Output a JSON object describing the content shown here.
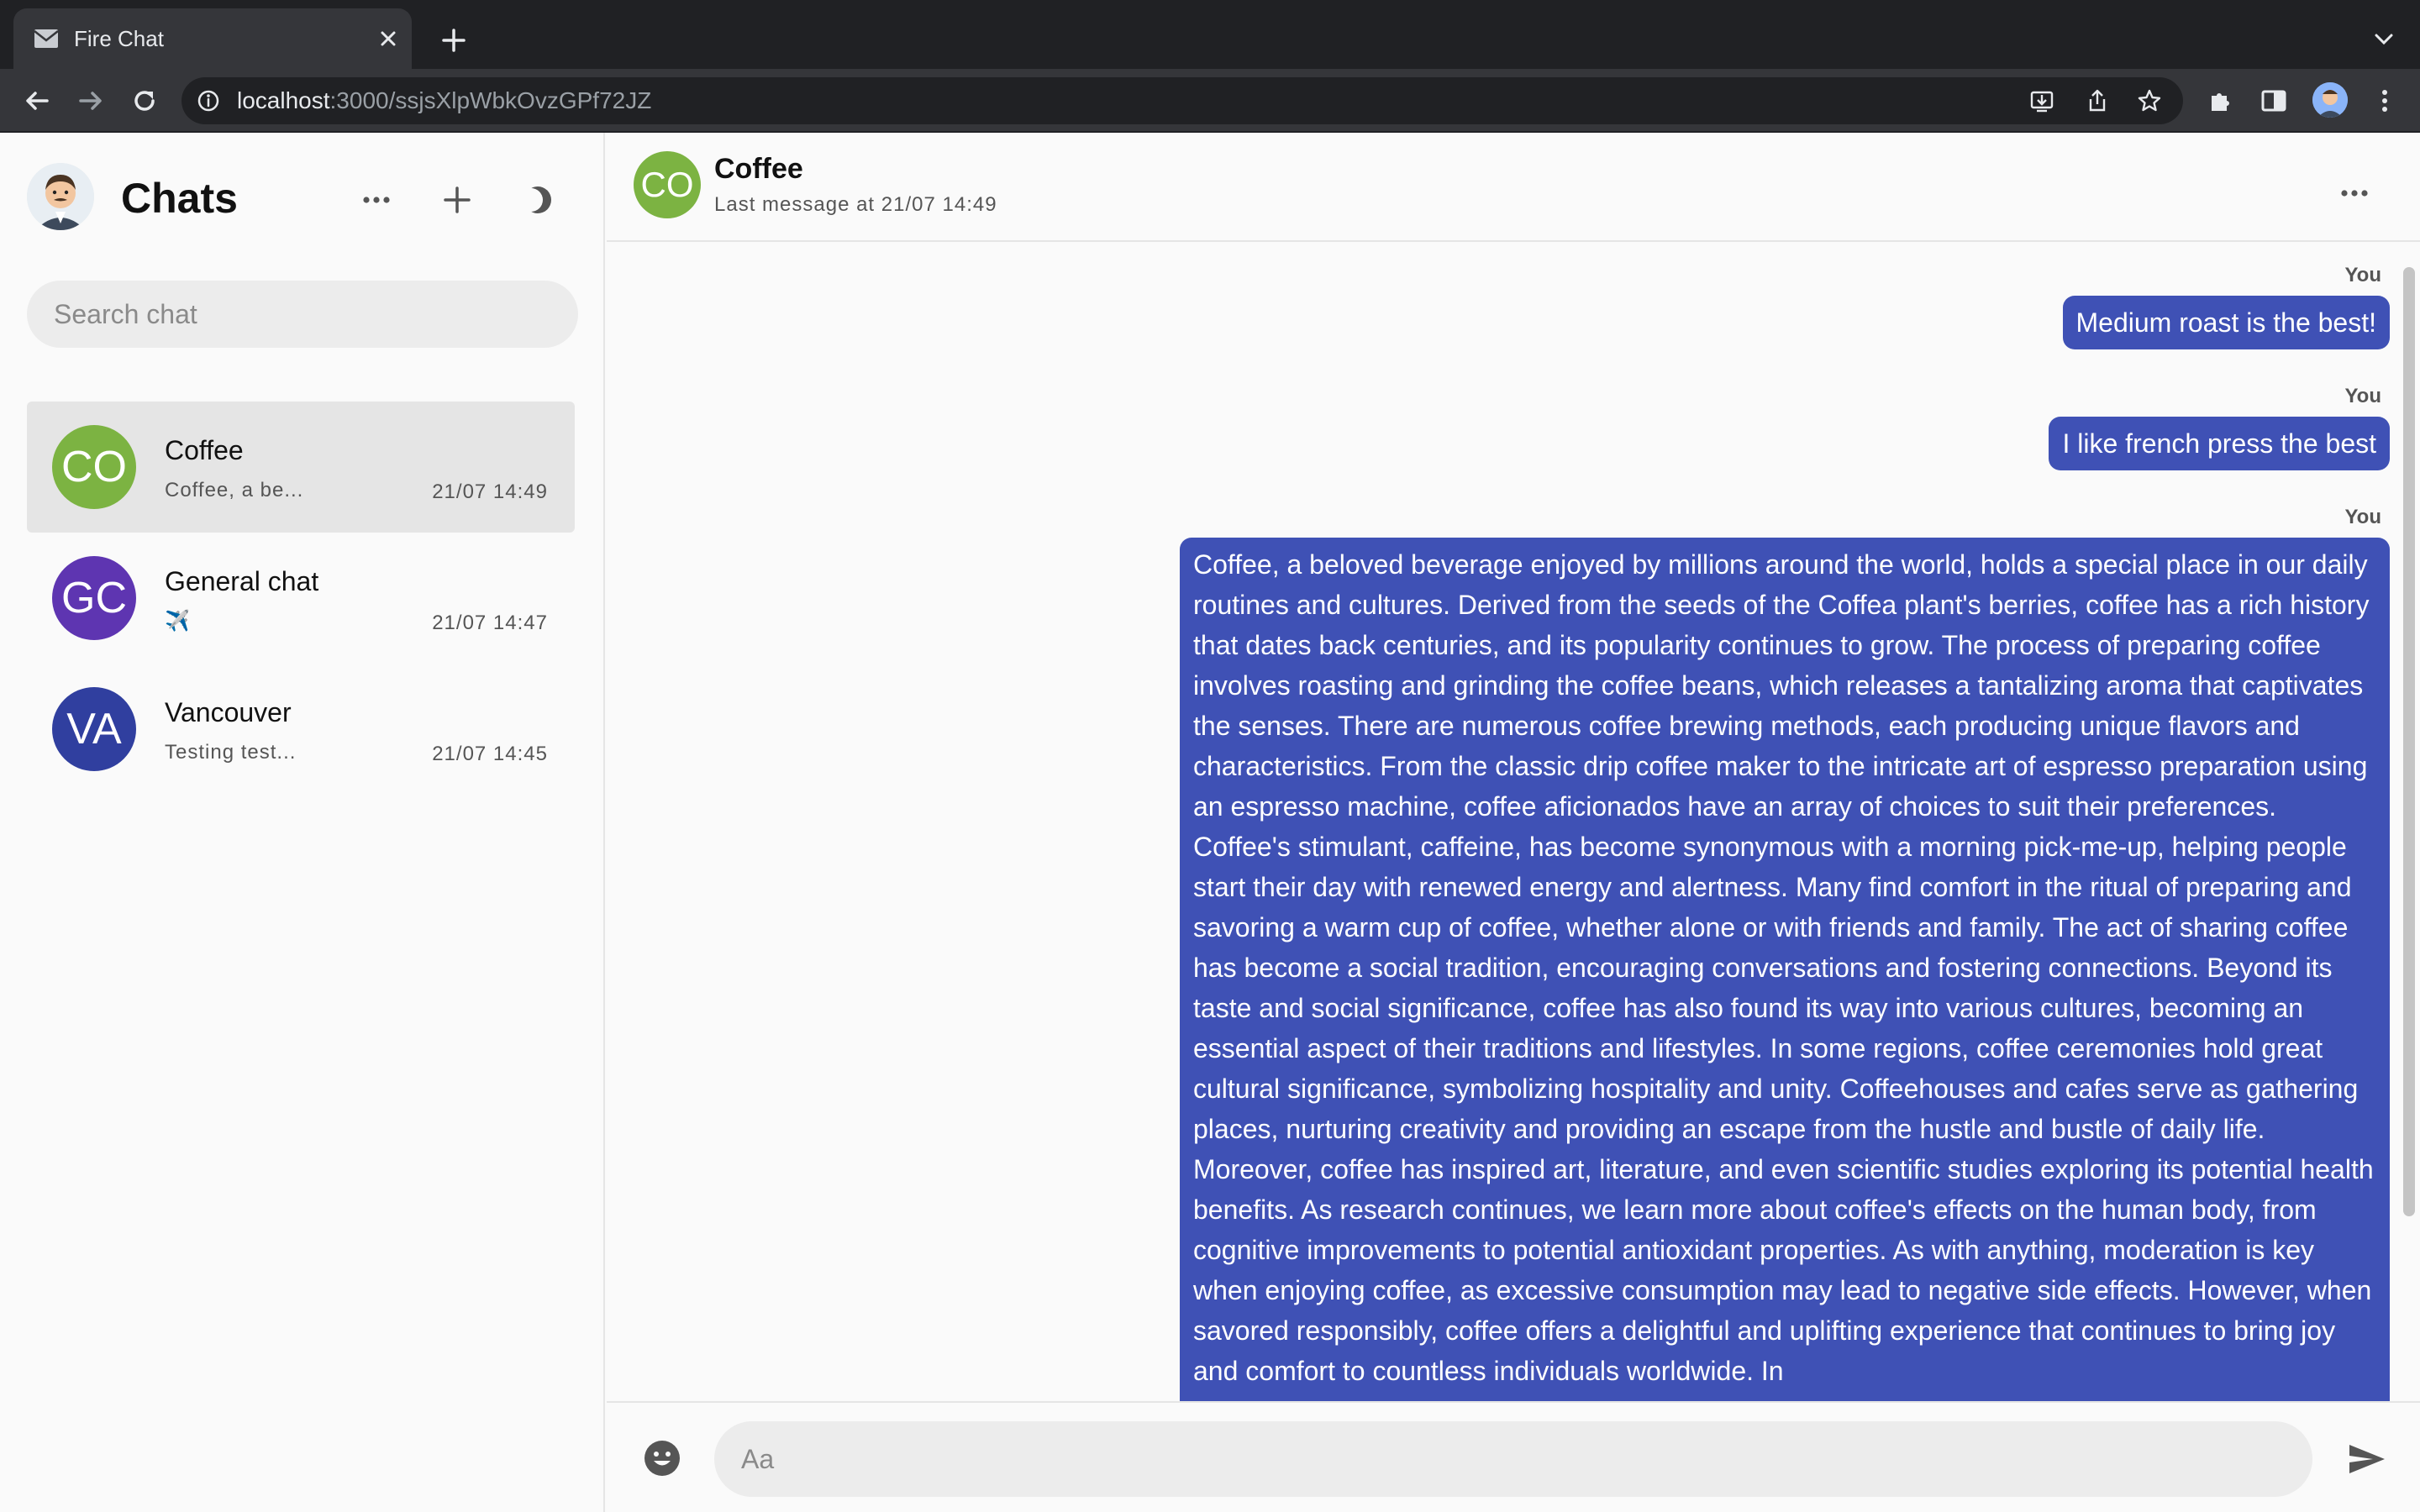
{
  "browser": {
    "tab_title": "Fire Chat",
    "url_host": "localhost",
    "url_path": ":3000/ssjsXlpWbkOvzGPf72JZ"
  },
  "sidebar": {
    "title": "Chats",
    "search_placeholder": "Search chat",
    "chats": [
      {
        "initials": "CO",
        "name": "Coffee",
        "preview": "Coffee, a be...",
        "time": "21/07 14:49",
        "color": "#7cb342",
        "active": true
      },
      {
        "initials": "GC",
        "name": "General chat",
        "preview": "✈️",
        "time": "21/07 14:47",
        "color": "#5e35b1",
        "active": false
      },
      {
        "initials": "VA",
        "name": "Vancouver",
        "preview": "Testing test...",
        "time": "21/07 14:45",
        "color": "#303f9f",
        "active": false
      }
    ]
  },
  "conversation": {
    "initials": "CO",
    "title": "Coffee",
    "subtitle": "Last message at 21/07 14:49",
    "accent": "#3f51b5",
    "messages": [
      {
        "sender": "You",
        "text": "Medium roast is the best!"
      },
      {
        "sender": "You",
        "text": "I like french press the best"
      },
      {
        "sender": "You",
        "text": "Coffee, a beloved beverage enjoyed by millions around the world, holds a special place in our daily routines and cultures. Derived from the seeds of the Coffea plant's berries, coffee has a rich history that dates back centuries, and its popularity continues to grow. The process of preparing coffee involves roasting and grinding the coffee beans, which releases a tantalizing aroma that captivates the senses. There are numerous coffee brewing methods, each producing unique flavors and characteristics. From the classic drip coffee maker to the intricate art of espresso preparation using an espresso machine, coffee aficionados have an array of choices to suit their preferences. Coffee's stimulant, caffeine, has become synonymous with a morning pick-me-up, helping people start their day with renewed energy and alertness. Many find comfort in the ritual of preparing and savoring a warm cup of coffee, whether alone or with friends and family. The act of sharing coffee has become a social tradition, encouraging conversations and fostering connections. Beyond its taste and social significance, coffee has also found its way into various cultures, becoming an essential aspect of their traditions and lifestyles. In some regions, coffee ceremonies hold great cultural significance, symbolizing hospitality and unity. Coffeehouses and cafes serve as gathering places, nurturing creativity and providing an escape from the hustle and bustle of daily life. Moreover, coffee has inspired art, literature, and even scientific studies exploring its potential health benefits. As research continues, we learn more about coffee's effects on the human body, from cognitive improvements to potential antioxidant properties. As with anything, moderation is key when enjoying coffee, as excessive consumption may lead to negative side effects. However, when savored responsibly, coffee offers a delightful and uplifting experience that continues to bring joy and comfort to countless individuals worldwide. In"
      }
    ],
    "composer_placeholder": "Aa"
  },
  "icons": {
    "tab_favicon": "mail-icon",
    "theme_toggle": "moon-icon",
    "send": "send-icon",
    "emoji": "emoji-icon"
  }
}
